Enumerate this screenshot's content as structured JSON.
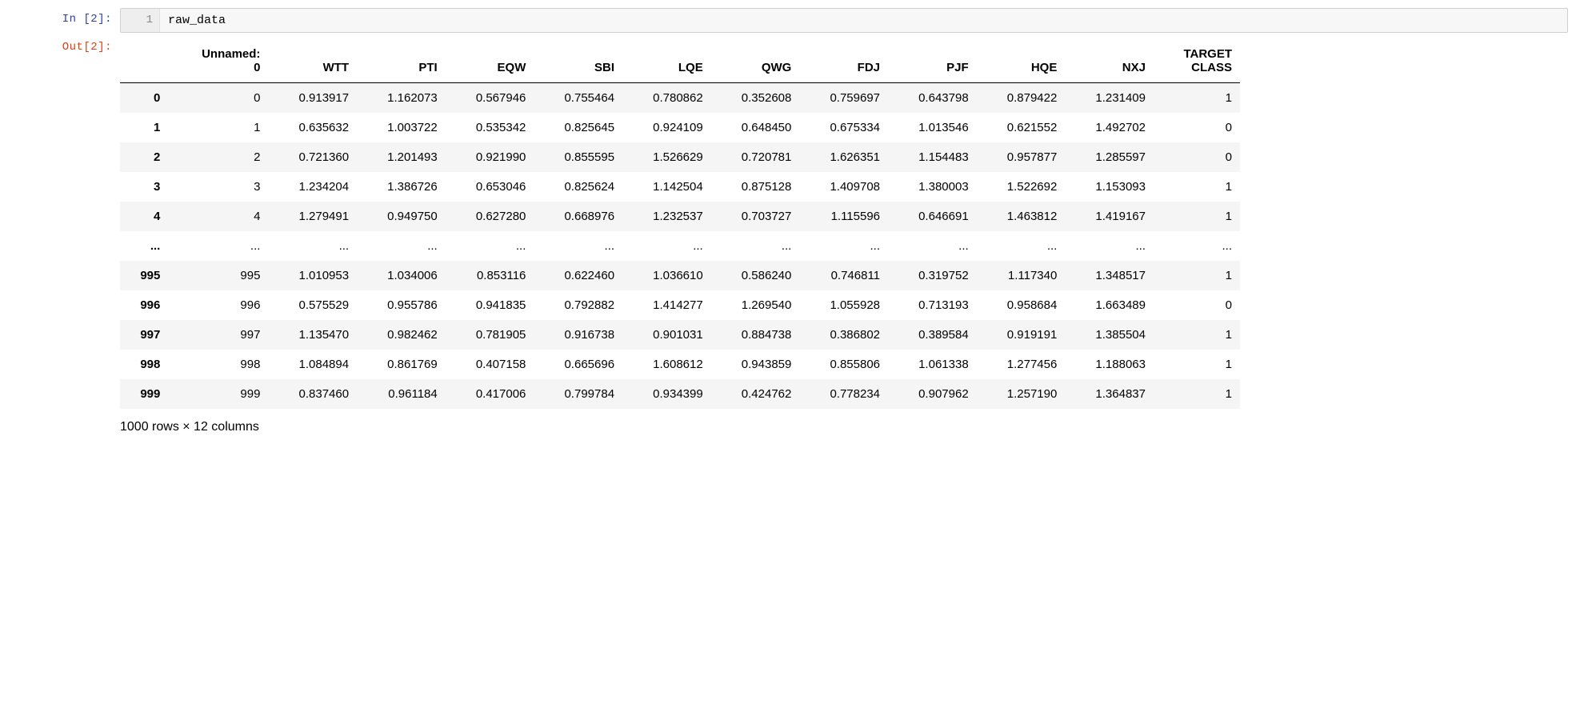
{
  "input_cell": {
    "prompt": "In [2]:",
    "line_number": "1",
    "code": "raw_data"
  },
  "output_cell": {
    "prompt": "Out[2]:",
    "columns": [
      "",
      "Unnamed:\n0",
      "WTT",
      "PTI",
      "EQW",
      "SBI",
      "LQE",
      "QWG",
      "FDJ",
      "PJF",
      "HQE",
      "NXJ",
      "TARGET\nCLASS"
    ],
    "rows": [
      {
        "idx": "0",
        "cells": [
          "0",
          "0.913917",
          "1.162073",
          "0.567946",
          "0.755464",
          "0.780862",
          "0.352608",
          "0.759697",
          "0.643798",
          "0.879422",
          "1.231409",
          "1"
        ]
      },
      {
        "idx": "1",
        "cells": [
          "1",
          "0.635632",
          "1.003722",
          "0.535342",
          "0.825645",
          "0.924109",
          "0.648450",
          "0.675334",
          "1.013546",
          "0.621552",
          "1.492702",
          "0"
        ]
      },
      {
        "idx": "2",
        "cells": [
          "2",
          "0.721360",
          "1.201493",
          "0.921990",
          "0.855595",
          "1.526629",
          "0.720781",
          "1.626351",
          "1.154483",
          "0.957877",
          "1.285597",
          "0"
        ]
      },
      {
        "idx": "3",
        "cells": [
          "3",
          "1.234204",
          "1.386726",
          "0.653046",
          "0.825624",
          "1.142504",
          "0.875128",
          "1.409708",
          "1.380003",
          "1.522692",
          "1.153093",
          "1"
        ]
      },
      {
        "idx": "4",
        "cells": [
          "4",
          "1.279491",
          "0.949750",
          "0.627280",
          "0.668976",
          "1.232537",
          "0.703727",
          "1.115596",
          "0.646691",
          "1.463812",
          "1.419167",
          "1"
        ]
      },
      {
        "idx": "...",
        "cells": [
          "...",
          "...",
          "...",
          "...",
          "...",
          "...",
          "...",
          "...",
          "...",
          "...",
          "...",
          "..."
        ]
      },
      {
        "idx": "995",
        "cells": [
          "995",
          "1.010953",
          "1.034006",
          "0.853116",
          "0.622460",
          "1.036610",
          "0.586240",
          "0.746811",
          "0.319752",
          "1.117340",
          "1.348517",
          "1"
        ]
      },
      {
        "idx": "996",
        "cells": [
          "996",
          "0.575529",
          "0.955786",
          "0.941835",
          "0.792882",
          "1.414277",
          "1.269540",
          "1.055928",
          "0.713193",
          "0.958684",
          "1.663489",
          "0"
        ]
      },
      {
        "idx": "997",
        "cells": [
          "997",
          "1.135470",
          "0.982462",
          "0.781905",
          "0.916738",
          "0.901031",
          "0.884738",
          "0.386802",
          "0.389584",
          "0.919191",
          "1.385504",
          "1"
        ]
      },
      {
        "idx": "998",
        "cells": [
          "998",
          "1.084894",
          "0.861769",
          "0.407158",
          "0.665696",
          "1.608612",
          "0.943859",
          "0.855806",
          "1.061338",
          "1.277456",
          "1.188063",
          "1"
        ]
      },
      {
        "idx": "999",
        "cells": [
          "999",
          "0.837460",
          "0.961184",
          "0.417006",
          "0.799784",
          "0.934399",
          "0.424762",
          "0.778234",
          "0.907962",
          "1.257190",
          "1.364837",
          "1"
        ]
      }
    ],
    "shape_note": "1000 rows × 12 columns"
  }
}
